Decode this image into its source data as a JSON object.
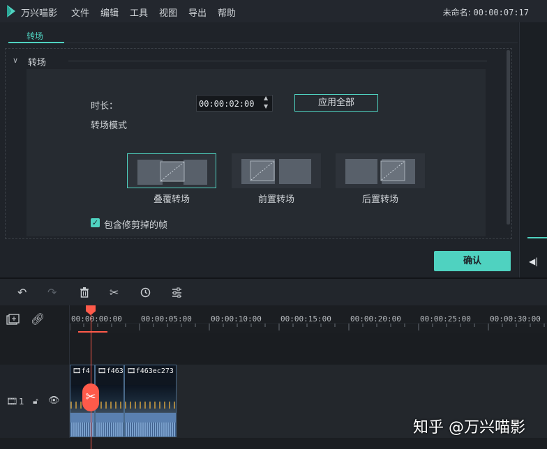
{
  "app": {
    "name": "万兴喵影",
    "menu": [
      "文件",
      "编辑",
      "工具",
      "视图",
      "导出",
      "帮助"
    ],
    "project": "未命名:",
    "time": "00:00:07:17"
  },
  "panel": {
    "tab": "转场",
    "section": "转场",
    "duration_label": "时长：",
    "duration_value": "00:00:02:00",
    "apply_all": "应用全部",
    "mode_label": "转场模式",
    "modes": [
      {
        "label": "叠覆转场",
        "selected": true
      },
      {
        "label": "前置转场",
        "selected": false
      },
      {
        "label": "后置转场",
        "selected": false
      }
    ],
    "checkbox_label": "包含修剪掉的帧",
    "checkbox_checked": true,
    "confirm": "确认"
  },
  "toolbar": {
    "icons": [
      "undo-icon",
      "redo-icon",
      "delete-icon",
      "cut-icon",
      "clock-icon",
      "adjust-icon"
    ]
  },
  "timeline": {
    "ticks": [
      "00:00:00:00",
      "00:00:05:00",
      "00:00:10:00",
      "00:00:15:00",
      "00:00:20:00",
      "00:00:25:00",
      "00:00:30:00"
    ],
    "track_label": "1",
    "clips": [
      "f4",
      "f463",
      "f463ec273"
    ]
  },
  "watermark": "知乎 @万兴喵影",
  "colors": {
    "accent": "#4fd2c0",
    "playhead": "#ff5a4a"
  }
}
